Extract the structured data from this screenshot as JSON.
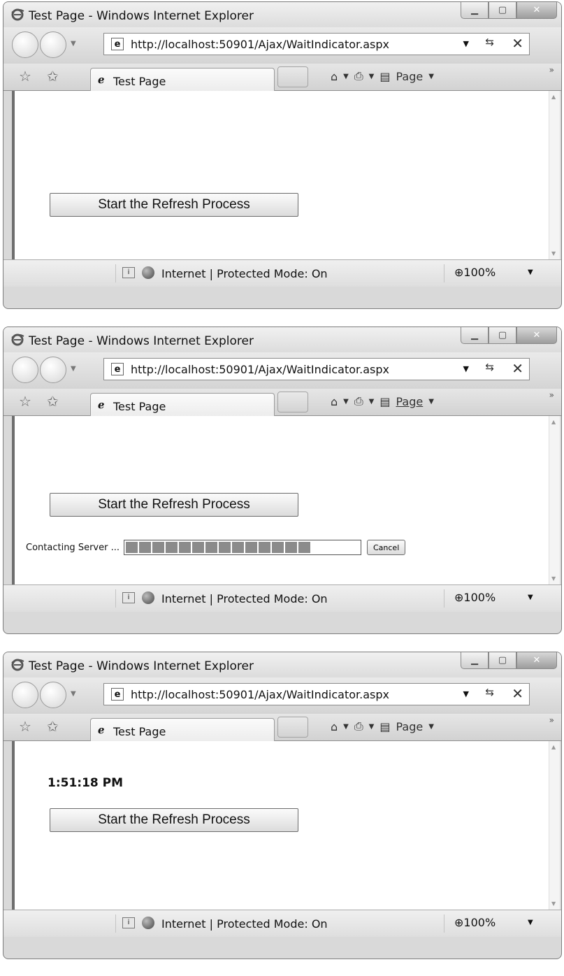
{
  "windows": [
    {
      "title": "Test Page - Windows Internet Explorer",
      "url": "http://localhost:50901/Ajax/WaitIndicator.aspx",
      "tab_label": "Test Page",
      "page_menu": "Page",
      "refresh_button": "Start the Refresh Process",
      "status_zone": "Internet | Protected Mode: On",
      "zoom": "100%"
    },
    {
      "title": "Test Page - Windows Internet Explorer",
      "url": "http://localhost:50901/Ajax/WaitIndicator.aspx",
      "tab_label": "Test Page",
      "page_menu": "Page",
      "refresh_button": "Start the Refresh Process",
      "wait_label": "Contacting Server ...",
      "progress_blocks": 14,
      "cancel_label": "Cancel",
      "status_zone": "Internet | Protected Mode: On",
      "zoom": "100%"
    },
    {
      "title": "Test Page - Windows Internet Explorer",
      "url": "http://localhost:50901/Ajax/WaitIndicator.aspx",
      "tab_label": "Test Page",
      "page_menu": "Page",
      "refresh_button": "Start the Refresh Process",
      "time_label": "1:51:18 PM",
      "status_zone": "Internet | Protected Mode: On",
      "zoom": "100%"
    }
  ]
}
